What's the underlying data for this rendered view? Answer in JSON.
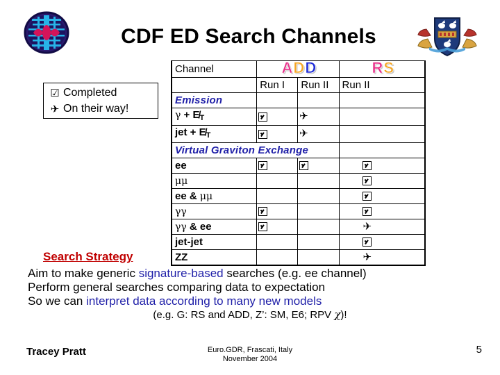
{
  "slide": {
    "title": "CDF ED Search Channels",
    "page_number": "5"
  },
  "logos": {
    "left": "cdf-logo",
    "right": "university-crest-logo"
  },
  "legend": {
    "items": [
      {
        "glyph": "checkbox-checked-icon",
        "label": "Completed"
      },
      {
        "glyph": "airplane-icon",
        "label": "On their way!"
      }
    ]
  },
  "table": {
    "header": {
      "channel": "Channel",
      "group_add": "ADD",
      "group_rs": "RS",
      "sub_run1": "Run I",
      "sub_run2": "Run II",
      "sub_run3": "Run II"
    },
    "sections": [
      {
        "label": "Emission"
      },
      {
        "label": "Virtual Graviton Exchange"
      }
    ],
    "rows": [
      {
        "section": "Emission",
        "channel": "γ + E̸",
        "channel_sub": "T",
        "add_run1": "check",
        "add_run2": "plane",
        "rs_run2": ""
      },
      {
        "section": "Emission",
        "channel": "jet + E̸",
        "channel_sub": "T",
        "add_run1": "check",
        "add_run2": "plane",
        "rs_run2": ""
      },
      {
        "section": "Virtual Graviton Exchange",
        "channel": "ee",
        "channel_sub": "",
        "add_run1": "check",
        "add_run2": "check",
        "rs_run2": "check"
      },
      {
        "section": "Virtual Graviton Exchange",
        "channel": "μμ",
        "channel_sub": "",
        "add_run1": "",
        "add_run2": "",
        "rs_run2": "check"
      },
      {
        "section": "Virtual Graviton Exchange",
        "channel": "ee & μμ",
        "channel_sub": "",
        "add_run1": "",
        "add_run2": "",
        "rs_run2": "check"
      },
      {
        "section": "Virtual Graviton Exchange",
        "channel": "γγ",
        "channel_sub": "",
        "add_run1": "check",
        "add_run2": "",
        "rs_run2": "check"
      },
      {
        "section": "Virtual Graviton Exchange",
        "channel": "γγ & ee",
        "channel_sub": "",
        "add_run1": "check",
        "add_run2": "",
        "rs_run2": "plane"
      },
      {
        "section": "Virtual Graviton Exchange",
        "channel": "jet-jet",
        "channel_sub": "",
        "add_run1": "",
        "add_run2": "",
        "rs_run2": "check"
      },
      {
        "section": "Virtual Graviton Exchange",
        "channel": "ZZ",
        "channel_sub": "",
        "add_run1": "",
        "add_run2": "",
        "rs_run2": "plane"
      }
    ]
  },
  "strategy": {
    "heading": "Search Strategy",
    "line1_a": "Aim to make generic ",
    "line1_b": "signature-based",
    "line1_c": " searches (e.g. ee channel)",
    "line2": "Perform general searches comparing data to expectation",
    "line3_a": "So we can ",
    "line3_b": "interpret data according to many new models",
    "line4_a": "(e.g. G: RS and ADD, Z’: SM, E6; RPV ",
    "line4_chi": "χ",
    "line4_b": ")!"
  },
  "footer": {
    "author": "Tracey Pratt",
    "venue_line1": "Euro.GDR, Frascati, Italy",
    "venue_line2": "November 2004",
    "page": "5"
  },
  "colors": {
    "section_blue": "#1f1fa8",
    "heading_red": "#c00000",
    "body_blue": "#1f1fa8",
    "wordart_a": "#e8308a",
    "wordart_d1": "#f5a623",
    "wordart_d2": "#1a28d8",
    "wordart_r": "#e8308a",
    "wordart_s": "#f5a623"
  }
}
